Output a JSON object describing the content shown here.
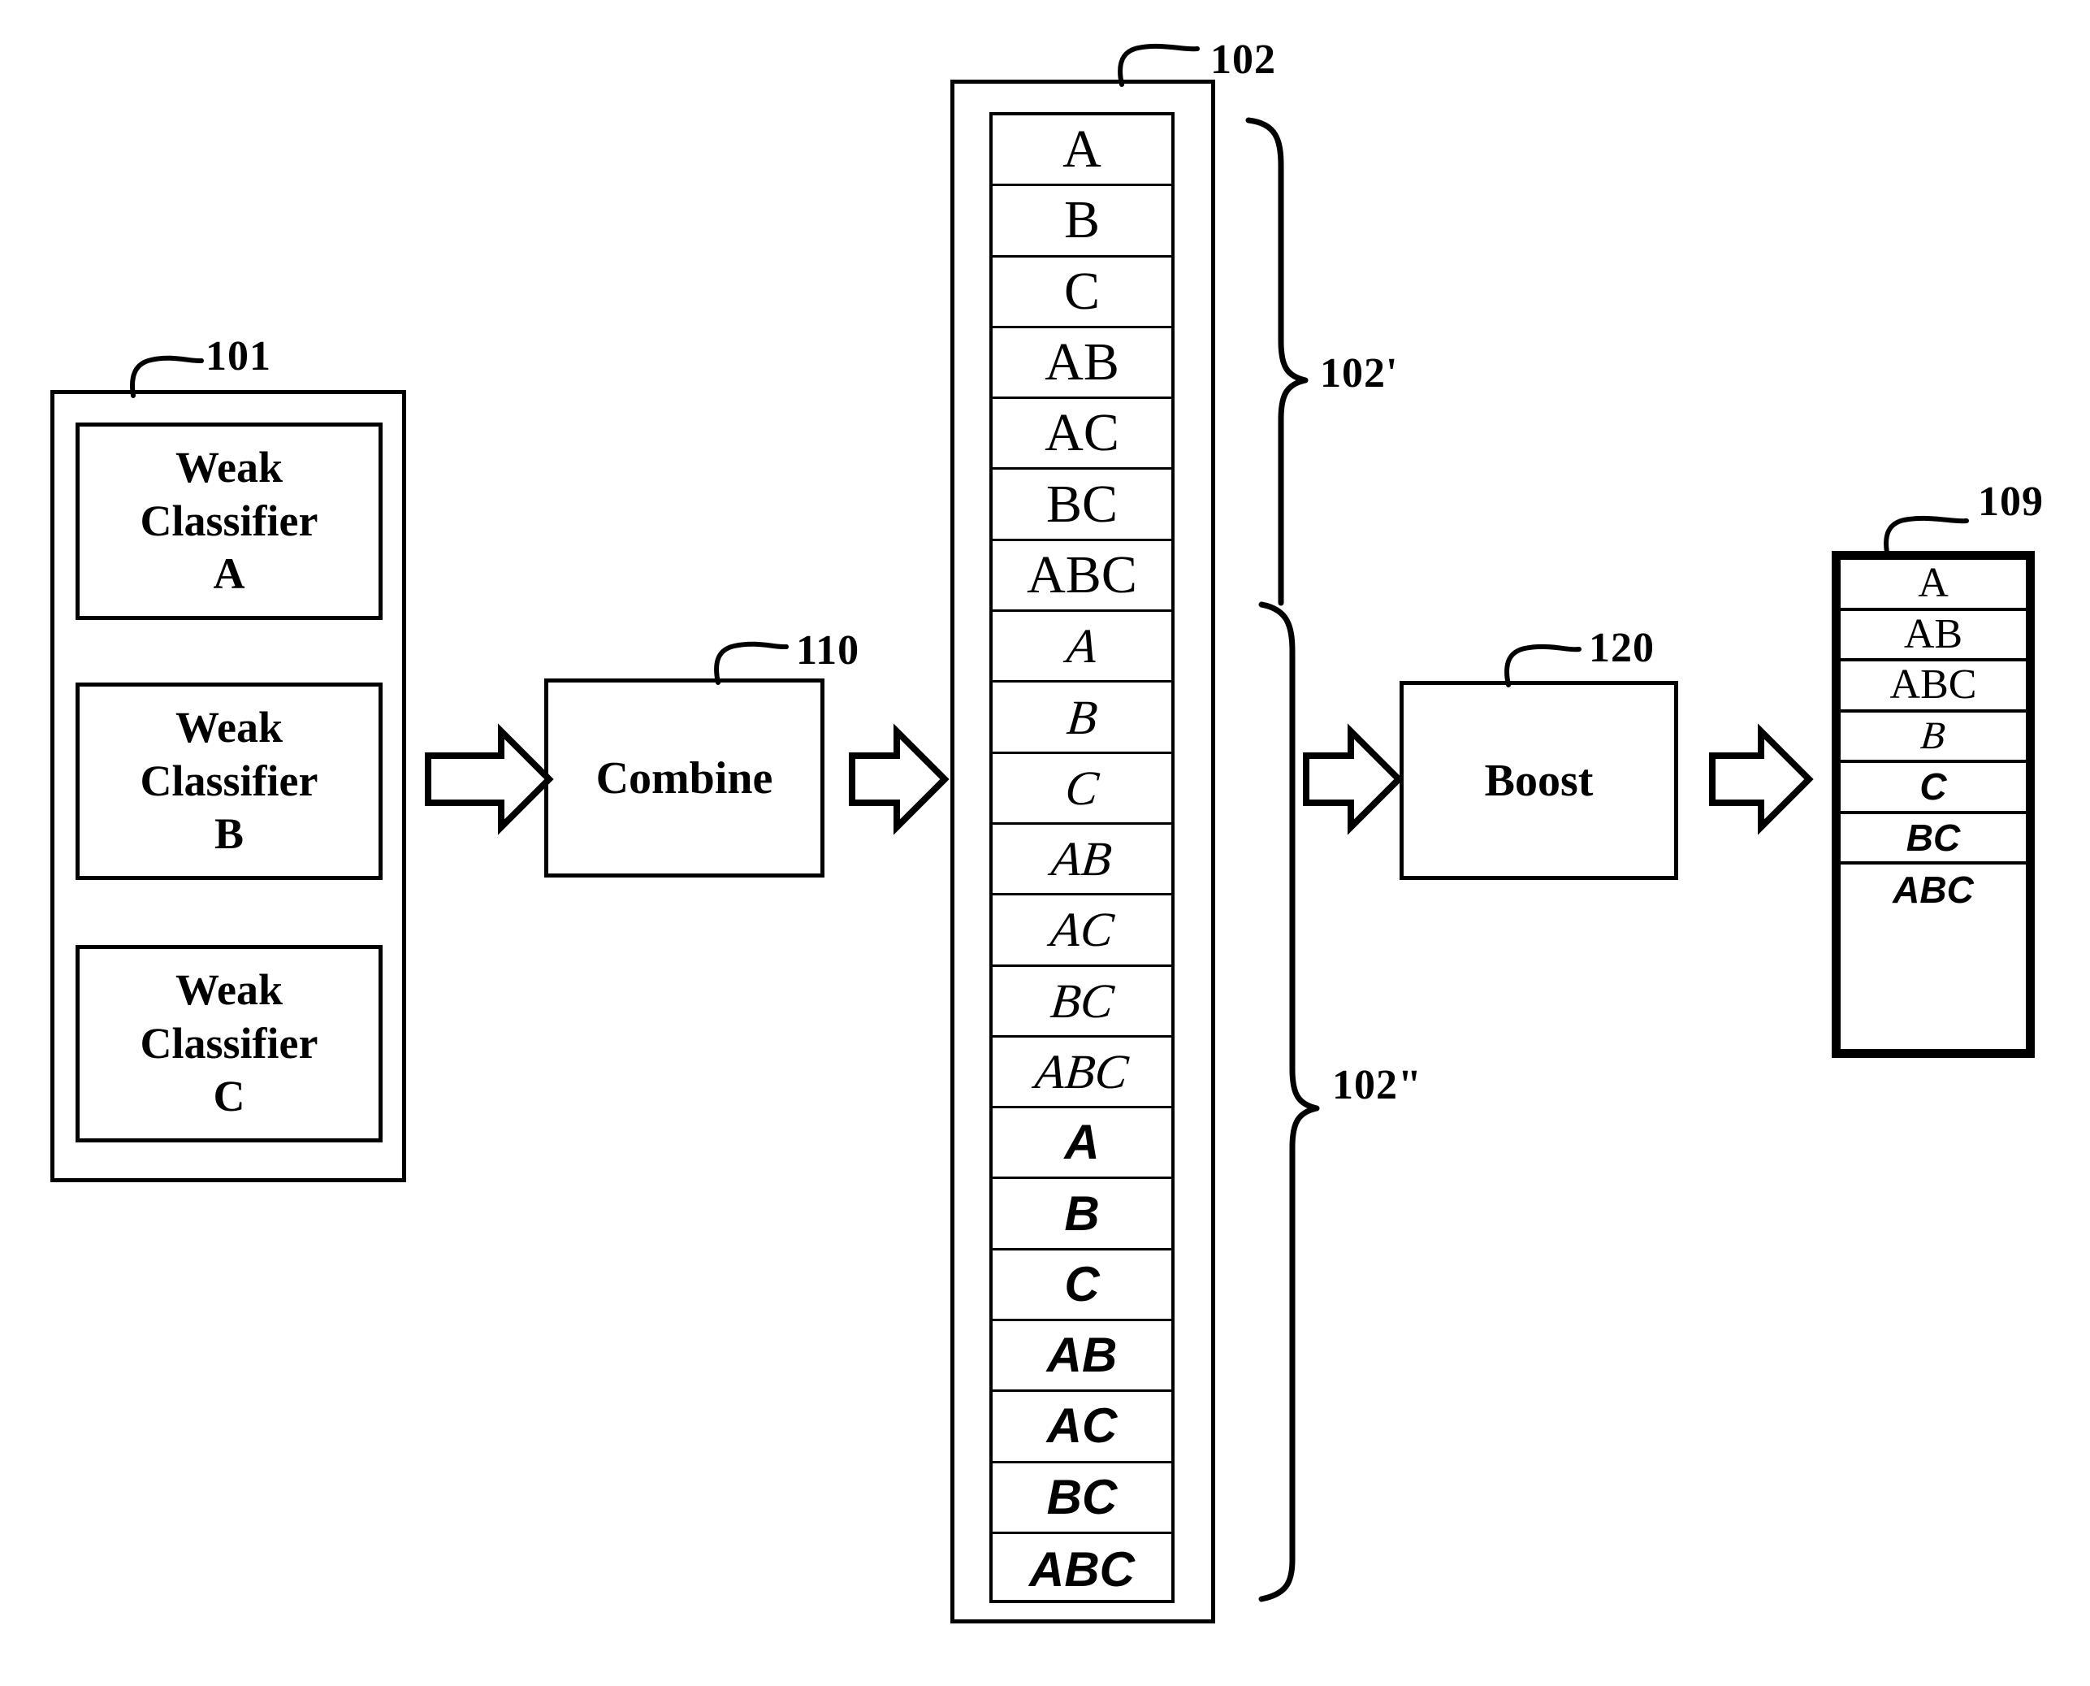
{
  "figure": {
    "title": "Boosting of combined weak classifiers",
    "background": "#ffffff",
    "ink_color": "#000000"
  },
  "refs": {
    "weak_bank": "101",
    "combine": "110",
    "pool": "102",
    "pool_group_upper": "102'",
    "pool_group_lower": "102\"",
    "boost": "120",
    "output": "109"
  },
  "weak_bank": {
    "items": [
      {
        "line1": "Weak",
        "line2": "Classifier",
        "line3": "A"
      },
      {
        "line1": "Weak",
        "line2": "Classifier",
        "line3": "B"
      },
      {
        "line1": "Weak",
        "line2": "Classifier",
        "line3": "C"
      }
    ]
  },
  "combine": {
    "label": "Combine"
  },
  "boost": {
    "label": "Boost"
  },
  "pool": {
    "rows": [
      {
        "text": "A",
        "style": "roman"
      },
      {
        "text": "B",
        "style": "roman"
      },
      {
        "text": "C",
        "style": "roman"
      },
      {
        "text": "AB",
        "style": "roman"
      },
      {
        "text": "AC",
        "style": "roman"
      },
      {
        "text": "BC",
        "style": "roman"
      },
      {
        "text": "ABC",
        "style": "roman"
      },
      {
        "text": "A",
        "style": "script"
      },
      {
        "text": "B",
        "style": "script"
      },
      {
        "text": "C",
        "style": "script"
      },
      {
        "text": "AB",
        "style": "script"
      },
      {
        "text": "AC",
        "style": "script"
      },
      {
        "text": "BC",
        "style": "script"
      },
      {
        "text": "ABC",
        "style": "script"
      },
      {
        "text": "A",
        "style": "bold"
      },
      {
        "text": "B",
        "style": "bold"
      },
      {
        "text": "C",
        "style": "bold"
      },
      {
        "text": "AB",
        "style": "bold"
      },
      {
        "text": "AC",
        "style": "bold"
      },
      {
        "text": "BC",
        "style": "bold"
      },
      {
        "text": "ABC",
        "style": "bold"
      }
    ]
  },
  "output": {
    "rows": [
      {
        "text": "A",
        "style": "roman"
      },
      {
        "text": "AB",
        "style": "roman"
      },
      {
        "text": "ABC",
        "style": "roman"
      },
      {
        "text": "B",
        "style": "script"
      },
      {
        "text": "C",
        "style": "bold"
      },
      {
        "text": "BC",
        "style": "bold"
      },
      {
        "text": "ABC",
        "style": "bold"
      }
    ]
  },
  "arrows": [
    {
      "name": "arrow-bank-to-combine"
    },
    {
      "name": "arrow-combine-to-pool"
    },
    {
      "name": "arrow-pool-to-boost"
    },
    {
      "name": "arrow-boost-to-output"
    }
  ]
}
